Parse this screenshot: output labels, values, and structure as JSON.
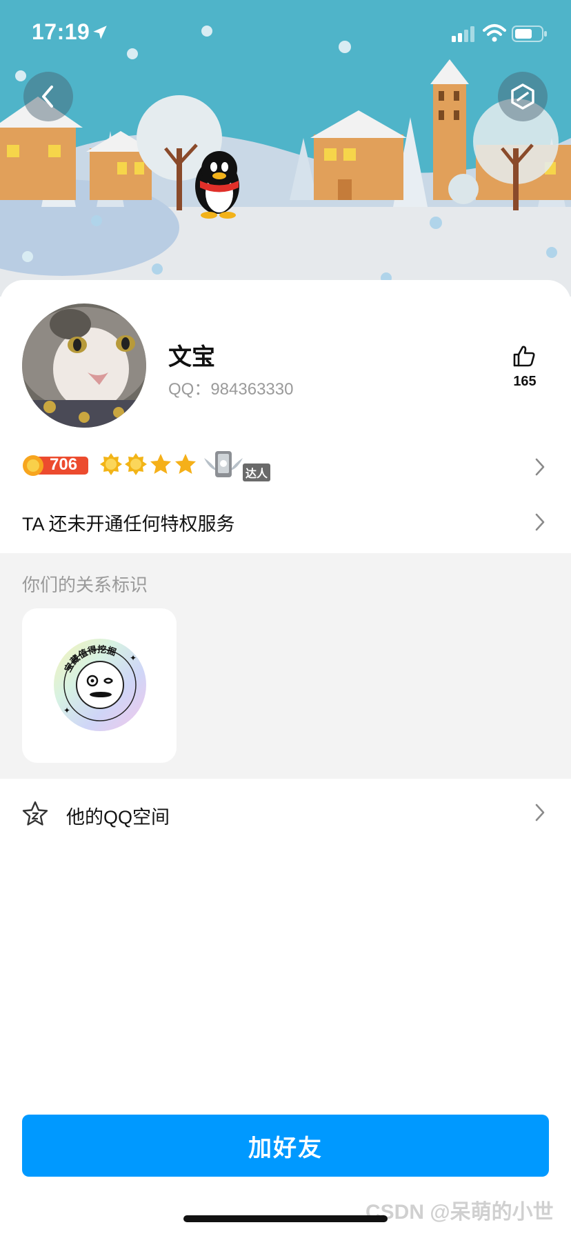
{
  "status_bar": {
    "time": "17:19"
  },
  "profile": {
    "nickname": "文宝",
    "qq_label": "QQ：984363330",
    "likes": "165"
  },
  "level": {
    "value": "706",
    "talent_label": "达人"
  },
  "privilege": {
    "text": "TA 还未开通任何特权服务"
  },
  "relation": {
    "title": "你们的关系标识",
    "badge_text": "宝藏值得挖掘"
  },
  "qzone": {
    "label": "他的QQ空间"
  },
  "action": {
    "add_friend": "加好友"
  },
  "watermark": "CSDN @呆萌的小世",
  "colors": {
    "accent": "#0099ff",
    "banner_sky": "#4fb4c9",
    "section_bg": "#f3f3f3"
  }
}
